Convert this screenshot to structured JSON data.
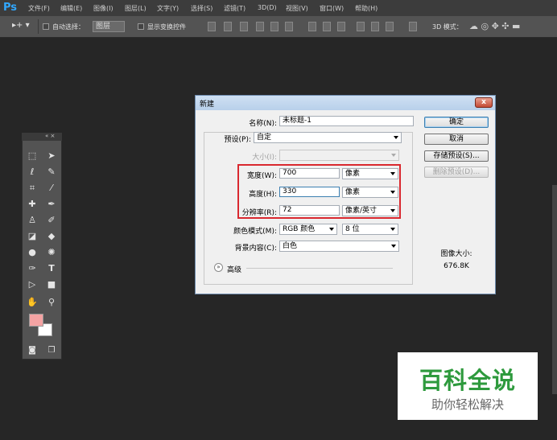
{
  "app": {
    "logo": "Ps"
  },
  "menu": [
    "文件(F)",
    "编辑(E)",
    "图像(I)",
    "图层(L)",
    "文字(Y)",
    "选择(S)",
    "滤镜(T)",
    "3D(D)",
    "视图(V)",
    "窗口(W)",
    "帮助(H)"
  ],
  "options": {
    "auto_select_label": "自动选择：",
    "layer_value": "图层",
    "show_transform_label": "显示变换控件",
    "mode_3d_label": "3D 模式："
  },
  "dialog": {
    "title": "新建",
    "close": "x",
    "name_label": "名称(N):",
    "name_value": "未标题-1",
    "preset_label": "预设(P):",
    "preset_value": "自定",
    "size_label": "大小(I):",
    "width_label": "宽度(W):",
    "width_value": "700",
    "width_unit": "像素",
    "height_label": "高度(H):",
    "height_value": "330",
    "height_unit": "像素",
    "resolution_label": "分辨率(R):",
    "resolution_value": "72",
    "resolution_unit": "像素/英寸",
    "color_mode_label": "颜色模式(M):",
    "color_mode_value": "RGB 颜色",
    "bit_depth_value": "8 位",
    "background_label": "背景内容(C):",
    "background_value": "白色",
    "advanced_label": "高级",
    "image_size_label": "图像大小:",
    "image_size_value": "676.8K",
    "buttons": {
      "ok": "确定",
      "cancel": "取消",
      "save_preset": "存储预设(S)...",
      "delete_preset": "删除预设(D)..."
    }
  },
  "colors": {
    "foreground": "#f4a3a3",
    "background": "#ffffff",
    "highlight": "#d9282f"
  },
  "watermark": {
    "main": "百科全说",
    "sub": "助你轻松解决"
  }
}
